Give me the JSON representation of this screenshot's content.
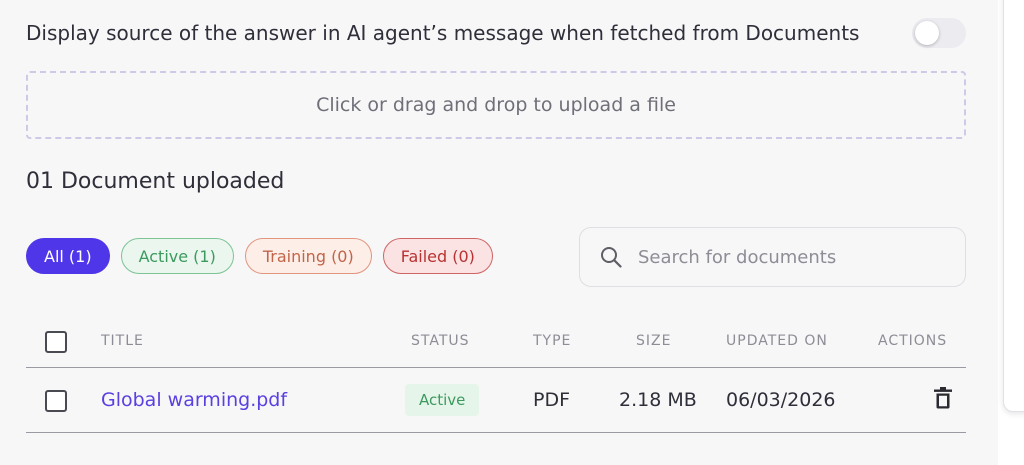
{
  "settings": {
    "source_toggle_label": "Display source of the answer in AI agent’s message when fetched from Documents",
    "source_toggle_on": false
  },
  "upload": {
    "prompt": "Click or drag and drop to upload a file"
  },
  "documents": {
    "count_label": "01 Document uploaded"
  },
  "filters": [
    {
      "label": "All (1)",
      "selected": true
    },
    {
      "label": "Active (1)",
      "selected": false
    },
    {
      "label": "Training (0)",
      "selected": false
    },
    {
      "label": "Failed (0)",
      "selected": false
    }
  ],
  "search": {
    "placeholder": "Search for documents",
    "icon": "search-icon"
  },
  "table": {
    "columns": [
      "TITLE",
      "STATUS",
      "TYPE",
      "SIZE",
      "UPDATED ON",
      "ACTIONS"
    ],
    "rows": [
      {
        "title": "Global warming.pdf",
        "status": "Active",
        "type": "PDF",
        "size": "2.18 MB",
        "updated_on": "06/03/2026",
        "action_icon": "trash-icon"
      }
    ]
  },
  "colors": {
    "accent": "#4f36e8",
    "link": "#5b3fe0",
    "active": "#3c9a5f",
    "training": "#c2644a",
    "failed": "#b83232"
  }
}
